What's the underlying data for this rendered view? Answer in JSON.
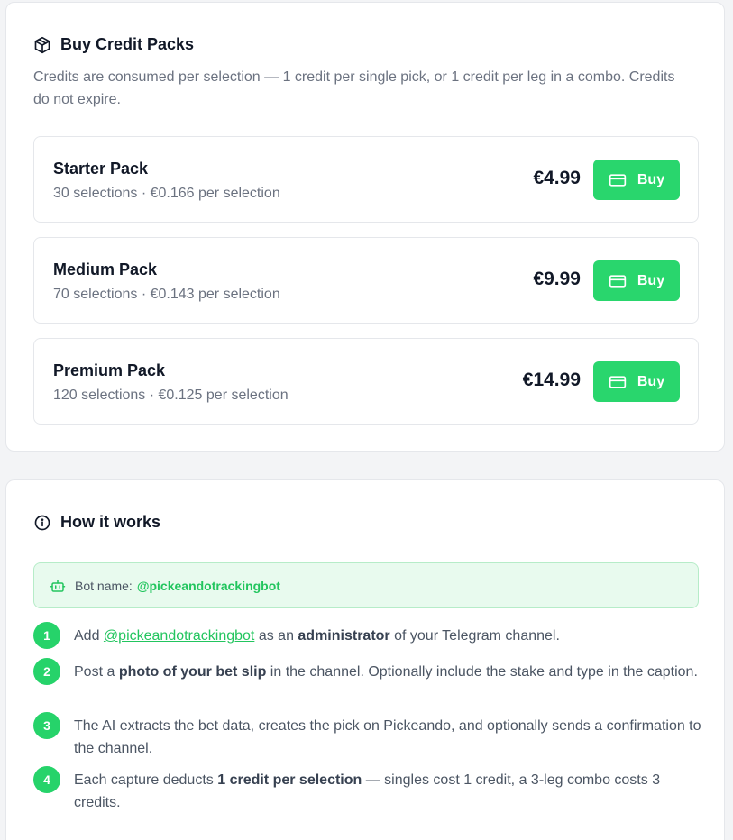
{
  "credit_packs": {
    "title": "Buy Credit Packs",
    "description": "Credits are consumed per selection — 1 credit per single pick, or 1 credit per leg in a combo. Credits do not expire.",
    "buy_label": "Buy",
    "packs": [
      {
        "name": "Starter Pack",
        "subtitle": "30 selections · €0.166 per selection",
        "price": "€4.99"
      },
      {
        "name": "Medium Pack",
        "subtitle": "70 selections · €0.143 per selection",
        "price": "€9.99"
      },
      {
        "name": "Premium Pack",
        "subtitle": "120 selections · €0.125 per selection",
        "price": "€14.99"
      }
    ]
  },
  "how_it_works": {
    "title": "How it works",
    "bot_label": "Bot name:",
    "bot_handle": "@pickeandotrackingbot",
    "steps": [
      {
        "number": "1",
        "pre": "Add ",
        "link": "@pickeandotrackingbot",
        "mid": " as an ",
        "bold": "administrator",
        "post": " of your Telegram channel."
      },
      {
        "number": "2",
        "pre": "Post a ",
        "bold": "photo of your bet slip",
        "post": " in the channel. Optionally include the stake and type in the caption."
      },
      {
        "number": "3",
        "text": "The AI extracts the bet data, creates the pick on Pickeando, and optionally sends a confirmation to the channel."
      },
      {
        "number": "4",
        "pre": "Each capture deducts ",
        "bold": "1 credit per selection",
        "post": " — singles cost 1 credit, a 3-leg combo costs 3 credits."
      }
    ]
  },
  "colors": {
    "accent": "#26d36a",
    "link": "#22c55e",
    "bot_box_bg": "#e8faee"
  },
  "icons": {
    "credit_packs_header": "package-icon",
    "how_it_works_header": "info-icon",
    "bot_box": "bot-icon",
    "buy_button": "credit-card-icon"
  }
}
